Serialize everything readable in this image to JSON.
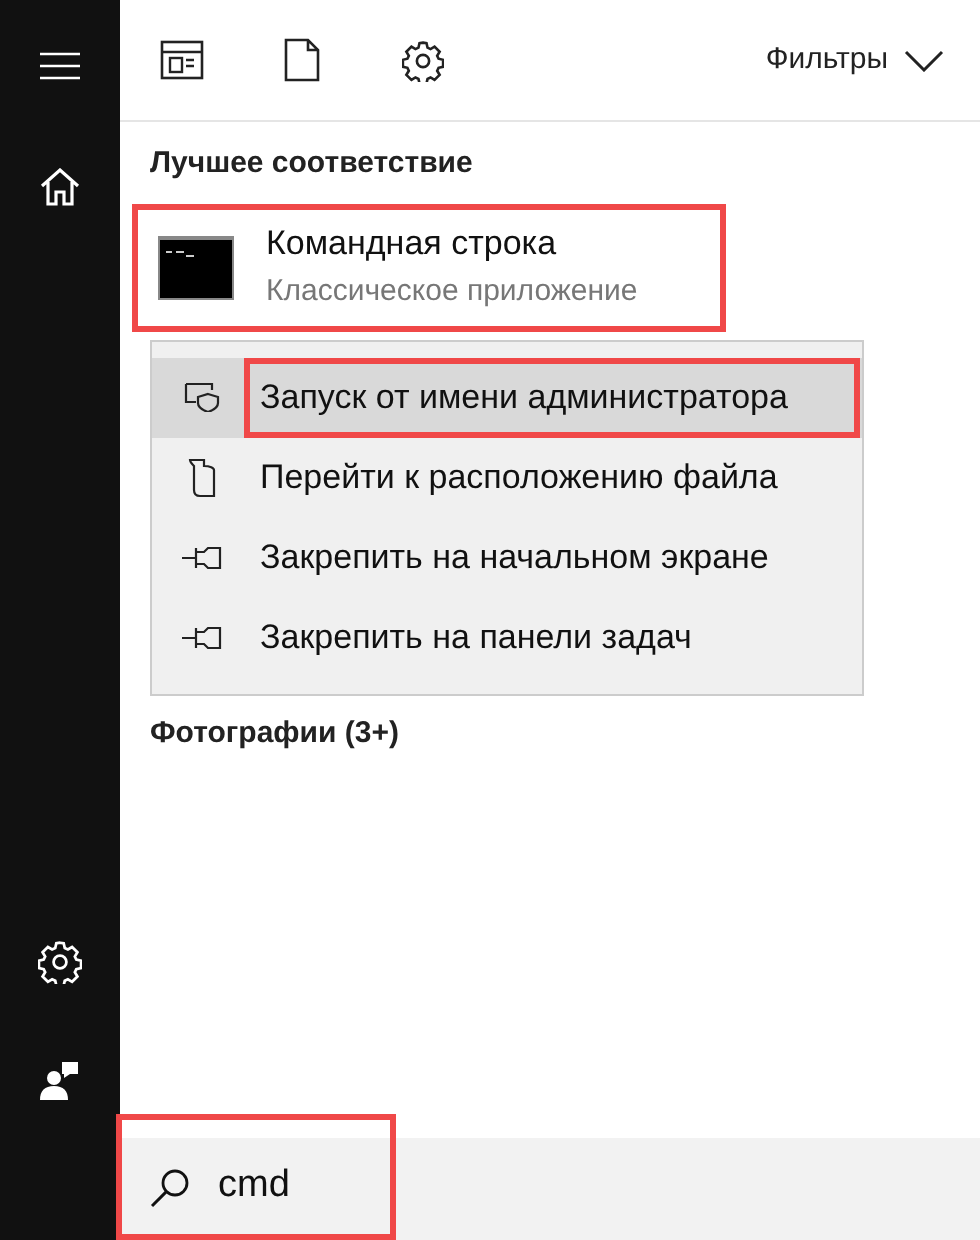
{
  "toolbar": {
    "filters_label": "Фильтры"
  },
  "best_match": {
    "heading": "Лучшее соответствие",
    "title": "Командная строка",
    "subtitle": "Классическое приложение",
    "annotated": true
  },
  "context_menu": [
    {
      "kind": "shield",
      "label": "Запуск от имени администратора",
      "selected": true,
      "annotated": true
    },
    {
      "kind": "folder",
      "label": "Перейти к расположению файла",
      "selected": false,
      "annotated": false
    },
    {
      "kind": "pin",
      "label": "Закрепить на начальном экране",
      "selected": false,
      "annotated": false
    },
    {
      "kind": "pin",
      "label": "Закрепить на панели задач",
      "selected": false,
      "annotated": false
    }
  ],
  "photos_heading": "Фотографии (3+)",
  "search": {
    "value": "cmd",
    "annotated": true
  }
}
